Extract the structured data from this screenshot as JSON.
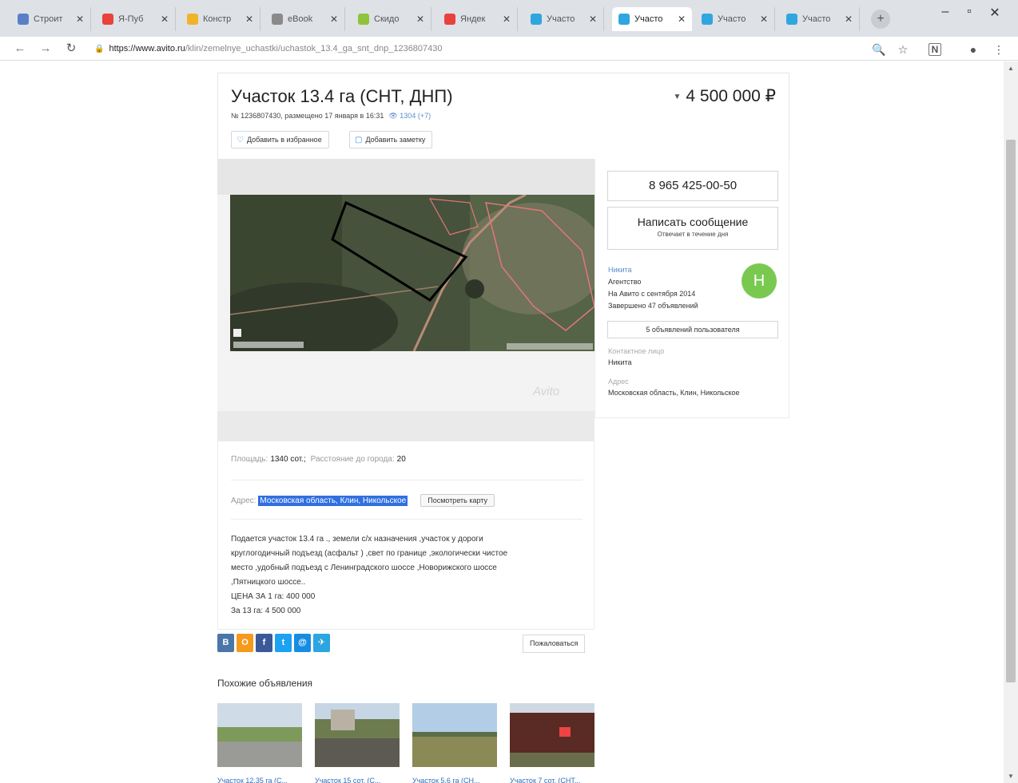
{
  "browser": {
    "tabs": [
      {
        "label": "Строит",
        "color": "#5a7fc6"
      },
      {
        "label": "Я-Пуб",
        "color": "#e8423d"
      },
      {
        "label": "Констр",
        "color": "#f0b429"
      },
      {
        "label": "eBook",
        "color": "#8a8a8a"
      },
      {
        "label": "Скидо",
        "color": "#8fc43a"
      },
      {
        "label": "Яндек",
        "color": "#e8423d"
      },
      {
        "label": "Участо",
        "color": "#2fa6df"
      },
      {
        "label": "Участо",
        "color": "#2fa6df"
      },
      {
        "label": "Участо",
        "color": "#2fa6df"
      },
      {
        "label": "Участо",
        "color": "#2fa6df"
      }
    ],
    "active_tab_index": 7,
    "new_tab": "+",
    "url_host": "https://www.avito.ru",
    "url_path": "/klin/zemelnye_uchastki/uchastok_13.4_ga_snt_dnp_1236807430",
    "window_controls": {
      "minimize": "–",
      "maximize": "▫",
      "close": "✕"
    }
  },
  "listing": {
    "title": "Участок 13.4 га (СНТ, ДНП)",
    "price": "4 500 000 ₽",
    "meta": "№ 1236807430, размещено 17 января в 16:31",
    "views": "1304 (+7)",
    "add_favorite_label": "Добавить в избранное",
    "add_note_label": "Добавить заметку",
    "watermark": "Avito"
  },
  "params": {
    "area_label": "Площадь:",
    "area_value": "1340 сот.;",
    "distance_label": "Расстояние до города:",
    "distance_value": "20",
    "address_label": "Адрес:",
    "address_value": "Московская область, Клин, Никольское",
    "show_map_label": "Посмотреть карту",
    "description": [
      "Подается участок 13.4 га ., земели с/х назначения ,участок у дороги",
      "круглогодичный подъезд (асфальт ) ,свет по границе ,экологически чистое",
      "место ,удобный подъезд с Ленинградского шоссе ,Новорижского шоссе",
      ",Пятницкого шоссе..",
      "ЦЕНА ЗА 1 га: 400 000",
      "За 13 га: 4 500 000"
    ]
  },
  "social": {
    "buttons": [
      {
        "label": "В",
        "color": "#4a76a8"
      },
      {
        "label": "О",
        "color": "#f59a1c"
      },
      {
        "label": "f",
        "color": "#3b5998"
      },
      {
        "label": "t",
        "color": "#1da1f2"
      },
      {
        "label": "@",
        "color": "#168de2"
      },
      {
        "label": "✈",
        "color": "#2ca5e0"
      }
    ],
    "complain_label": "Пожаловаться"
  },
  "similar": {
    "title": "Похожие объявления",
    "items": [
      {
        "caption": "Участок 12.35 га (С..."
      },
      {
        "caption": "Участок 15 сот. (С..."
      },
      {
        "caption": "Участок 5.6 га (СН..."
      },
      {
        "caption": "Участок 7 сот. (СНТ..."
      }
    ]
  },
  "seller": {
    "phone": "8 965 425-00-50",
    "write_message": "Написать сообщение",
    "reply_time": "Отвечает в течение дня",
    "name": "Никита",
    "type": "Агентство",
    "since": "На Авито с сентября 2014",
    "completed": "Завершено 47 объявлений",
    "avatar_letter": "Н",
    "all_ads": "5 объявлений пользователя",
    "contact_label": "Контактное лицо",
    "contact_value": "Никита",
    "address_label": "Адрес",
    "address_value": "Московская область, Клин, Никольское"
  }
}
